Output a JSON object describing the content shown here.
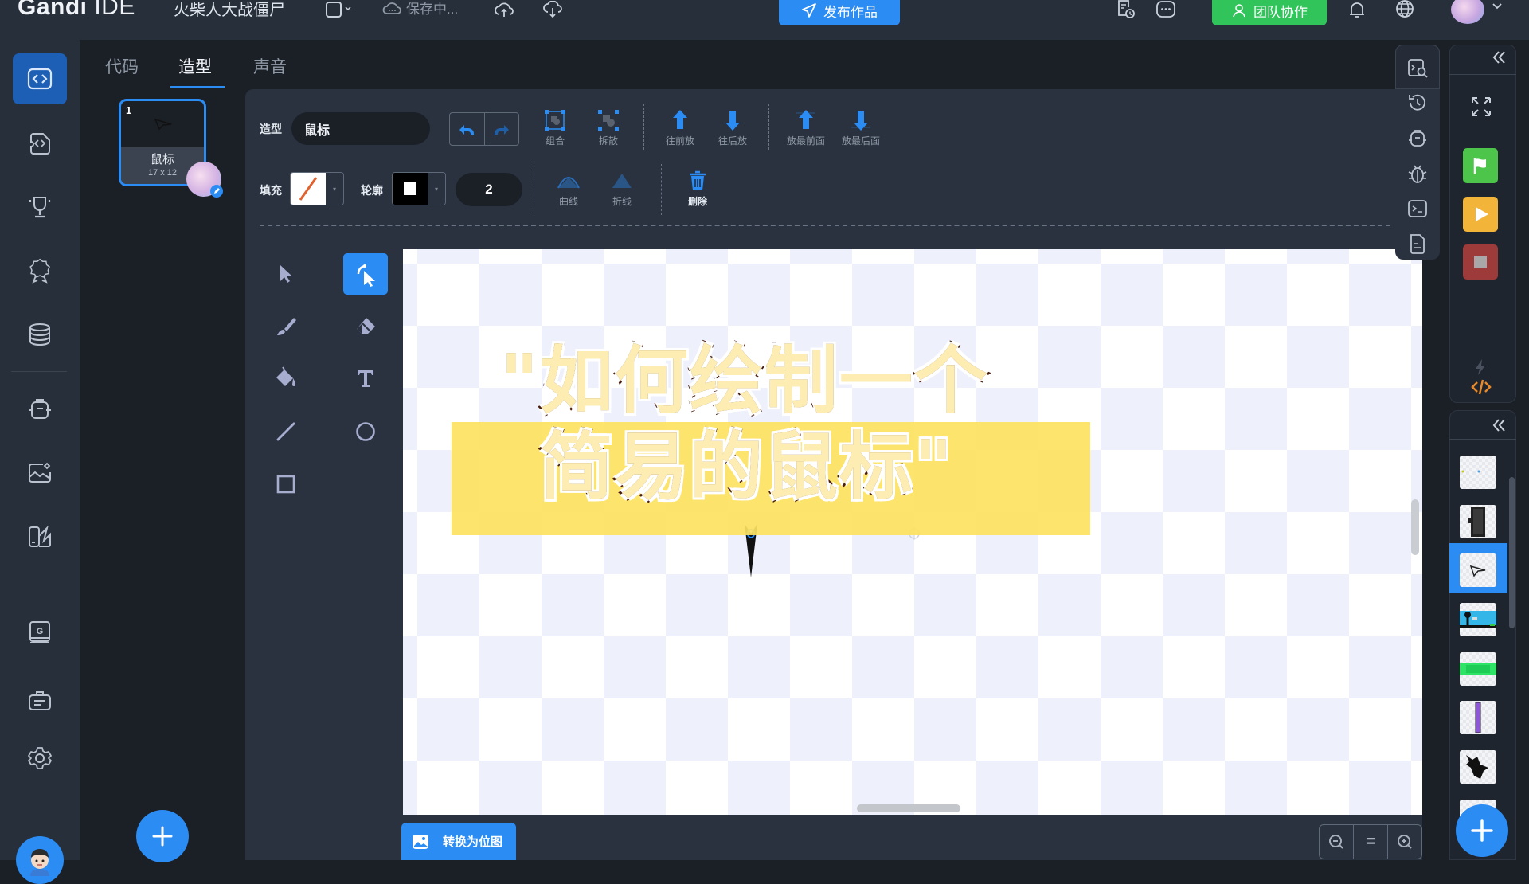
{
  "app": {
    "logo_bold": "Gandi",
    "logo_light": " IDE",
    "project_title": "火柴人大战僵尸",
    "save_status": "保存中...",
    "publish_label": "发布作品",
    "team_label": "团队协作"
  },
  "tabs": [
    {
      "label": "代码",
      "active": false
    },
    {
      "label": "造型",
      "active": true
    },
    {
      "label": "声音",
      "active": false
    }
  ],
  "left_nav": {
    "items": [
      {
        "icon": "code-editor-icon",
        "active": true
      },
      {
        "icon": "extension-icon"
      },
      {
        "icon": "trophy-icon"
      },
      {
        "icon": "badge-icon"
      },
      {
        "icon": "database-icon"
      },
      {
        "icon": "backpack-icon"
      },
      {
        "icon": "image-gallery-icon"
      },
      {
        "icon": "tutorial-icon"
      },
      {
        "icon": "gandi-guide-icon"
      },
      {
        "icon": "assets-icon"
      },
      {
        "icon": "settings-icon"
      }
    ]
  },
  "costume": {
    "index": "1",
    "name": "鼠标",
    "size": "17 x 12"
  },
  "editor": {
    "costume_label": "造型",
    "costume_name": "鼠标",
    "fill_label": "填充",
    "stroke_label": "轮廓",
    "stroke_width": "2",
    "actions_row1": [
      {
        "label": "组合",
        "icon": "group-icon"
      },
      {
        "label": "拆散",
        "icon": "ungroup-icon"
      },
      {
        "label": "往前放",
        "icon": "forward-icon"
      },
      {
        "label": "往后放",
        "icon": "backward-icon"
      },
      {
        "label": "放最前面",
        "icon": "front-icon"
      },
      {
        "label": "放最后面",
        "icon": "back-icon"
      }
    ],
    "actions_row2": [
      {
        "label": "曲线",
        "icon": "curve-icon"
      },
      {
        "label": "折线",
        "icon": "pointed-icon"
      },
      {
        "label": "删除",
        "icon": "delete-icon"
      }
    ],
    "tools": [
      {
        "name": "select",
        "active": false
      },
      {
        "name": "reshape",
        "active": true
      },
      {
        "name": "brush",
        "active": false
      },
      {
        "name": "eraser",
        "active": false
      },
      {
        "name": "fill",
        "active": false
      },
      {
        "name": "text",
        "active": false
      },
      {
        "name": "line",
        "active": false
      },
      {
        "name": "circle",
        "active": false
      },
      {
        "name": "rectangle",
        "active": false
      }
    ],
    "convert_bitmap_label": "转换为位图",
    "zoom_reset_label": "="
  },
  "overlay": {
    "line1": "\"如何绘制一个",
    "line2": "简易的鼠标\""
  },
  "colors": {
    "accent": "#2b8cf4",
    "team_green": "#31c45b",
    "green_flag": "#4dc44a",
    "run_yellow": "#f2b53a",
    "stop_red": "#9d3a3a",
    "caption_band": "#fde25f"
  }
}
